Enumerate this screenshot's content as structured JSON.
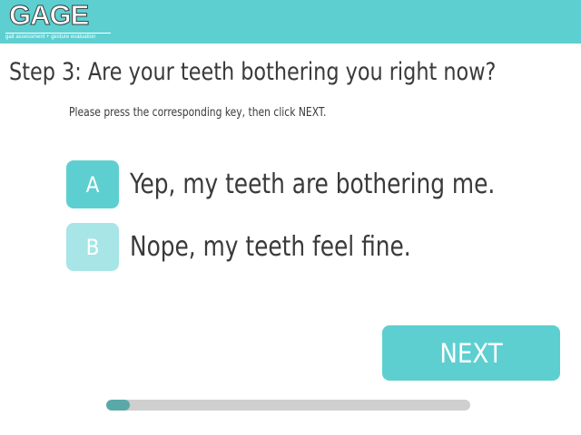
{
  "brand": {
    "logo_text": "GAGE",
    "tagline": "gait assessment + gesture evaluation",
    "accent_color": "#5ecfd1",
    "option_b_color": "#a7e5e7",
    "progress_color": "#5aa9a8"
  },
  "question": {
    "title": "Step 3: Are your teeth bothering you right now?",
    "instruction": "Please press the corresponding key, then click NEXT."
  },
  "options": [
    {
      "key": "A",
      "label": "Yep, my teeth are bothering me."
    },
    {
      "key": "B",
      "label": "Nope, my teeth feel fine."
    }
  ],
  "next_button": {
    "label": "NEXT"
  },
  "progress": {
    "fraction": 0.065
  }
}
